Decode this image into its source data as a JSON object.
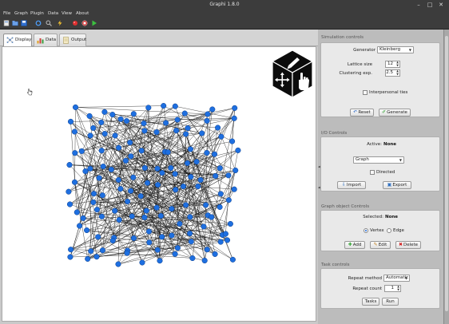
{
  "window": {
    "title": "Graphi 1.8.0"
  },
  "menu": [
    "File",
    "Graph",
    "Plugin",
    "Data",
    "View",
    "About"
  ],
  "tabs": [
    {
      "label": "Display",
      "active": true
    },
    {
      "label": "Data",
      "active": false
    },
    {
      "label": "Output",
      "active": false
    }
  ],
  "simulation": {
    "title": "Simulation controls",
    "generator_label": "Generator",
    "generator_value": "Kleinberg",
    "lattice_label": "Lattice size",
    "lattice_value": "12",
    "clustering_label": "Clustering exp.",
    "clustering_value": "2.5",
    "interpersonal_label": "Interpersonal ties",
    "reset_label": "Reset",
    "generate_label": "Generate"
  },
  "io": {
    "title": "I/O Controls",
    "active_label": "Active:",
    "active_value": "None",
    "type_value": "Graph",
    "directed_label": "Directed",
    "import_label": "Import",
    "export_label": "Export"
  },
  "graph_object": {
    "title": "Graph object Controls",
    "selected_label": "Selected:",
    "selected_value": "None",
    "vertex_label": "Vertex",
    "edge_label": "Edge",
    "add_label": "Add",
    "edit_label": "Edit",
    "delete_label": "Delete"
  },
  "task": {
    "title": "Task controls",
    "repeat_method_label": "Repeat method",
    "repeat_method_value": "Automatic",
    "repeat_count_label": "Repeat count",
    "repeat_count_value": "1",
    "tasks_label": "Tasks",
    "run_label": "Run"
  },
  "colors": {
    "node": "#1e6fe0",
    "edge": "#111111",
    "dark_chrome": "#3c3c3c"
  }
}
